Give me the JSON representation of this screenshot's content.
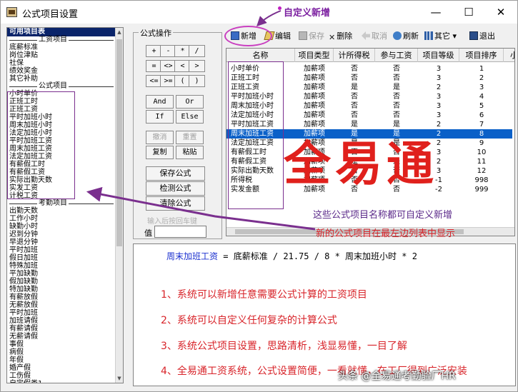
{
  "window": {
    "title": "公式项目设置",
    "min": "—",
    "max": "☐",
    "close": "✕"
  },
  "left_list": {
    "items": [
      {
        "type": "head",
        "text": "可用项目表"
      },
      {
        "type": "sep",
        "text": "工资项目"
      },
      {
        "type": "item",
        "text": "底薪标准"
      },
      {
        "type": "item",
        "text": "岗位津贴"
      },
      {
        "type": "item",
        "text": "社保"
      },
      {
        "type": "item",
        "text": "绩效奖金"
      },
      {
        "type": "item",
        "text": "其它补助"
      },
      {
        "type": "sep",
        "text": "公式项目"
      },
      {
        "type": "item",
        "text": "小时单价"
      },
      {
        "type": "item",
        "text": "正班工时"
      },
      {
        "type": "item",
        "text": "正班工资"
      },
      {
        "type": "item",
        "text": "平时加班小时"
      },
      {
        "type": "item",
        "text": "周末加班小时"
      },
      {
        "type": "item",
        "text": "法定加班小时"
      },
      {
        "type": "item",
        "text": "平时加班工资"
      },
      {
        "type": "item",
        "text": "周末加班工资"
      },
      {
        "type": "item",
        "text": "法定加班工资"
      },
      {
        "type": "item",
        "text": "有薪假工时"
      },
      {
        "type": "item",
        "text": "有薪假工资"
      },
      {
        "type": "item",
        "text": "实际出勤天数"
      },
      {
        "type": "item",
        "text": "实发工资"
      },
      {
        "type": "item",
        "text": "计税工资"
      },
      {
        "type": "sep",
        "text": "考勤项目"
      },
      {
        "type": "item",
        "text": "出勤天数"
      },
      {
        "type": "item",
        "text": "工作小时"
      },
      {
        "type": "item",
        "text": "缺勤小时"
      },
      {
        "type": "item",
        "text": "迟到分钟"
      },
      {
        "type": "item",
        "text": "早退分钟"
      },
      {
        "type": "item",
        "text": "平时加班"
      },
      {
        "type": "item",
        "text": "假日加班"
      },
      {
        "type": "item",
        "text": "特殊加班"
      },
      {
        "type": "item",
        "text": "平加缺勤"
      },
      {
        "type": "item",
        "text": "假加缺勤"
      },
      {
        "type": "item",
        "text": "特加缺勤"
      },
      {
        "type": "item",
        "text": "有薪放假"
      },
      {
        "type": "item",
        "text": "无薪放假"
      },
      {
        "type": "item",
        "text": "平时加班"
      },
      {
        "type": "item",
        "text": "加班请假"
      },
      {
        "type": "item",
        "text": "有薪请假"
      },
      {
        "type": "item",
        "text": "无薪请假"
      },
      {
        "type": "item",
        "text": "事假"
      },
      {
        "type": "item",
        "text": "病假"
      },
      {
        "type": "item",
        "text": "年假"
      },
      {
        "type": "item",
        "text": "婚产假"
      },
      {
        "type": "item",
        "text": "工伤假"
      },
      {
        "type": "item",
        "text": "自定假类1"
      }
    ]
  },
  "formula_ops": {
    "title": "公式操作",
    "operators": [
      "+",
      "-",
      "*",
      "/",
      "=",
      "<>",
      "<",
      ">",
      "<=",
      ">=",
      "(",
      ")"
    ],
    "and": "And",
    "or": "Or",
    "if": "If",
    "else": "Else",
    "undo": "撤消",
    "redo": "重置",
    "copy": "复制",
    "paste": "粘贴",
    "save": "保存公式",
    "check": "检测公式",
    "clear": "清除公式",
    "hint": "输入后按回车键",
    "value_label": "值"
  },
  "toolbar": {
    "new": "新增",
    "edit": "编辑",
    "save": "保存",
    "delete": "删除",
    "cancel": "取消",
    "refresh": "刷新",
    "other": "其它",
    "exit": "退出"
  },
  "table": {
    "columns": [
      "名称",
      "项目类型",
      "计所得税",
      "参与工资",
      "项目等级",
      "项目排序",
      "小"
    ],
    "rows": [
      [
        "小时单价",
        "加薪项",
        "否",
        "否",
        "3",
        "1"
      ],
      [
        "正班工时",
        "加薪项",
        "否",
        "否",
        "3",
        "2"
      ],
      [
        "正班工资",
        "加薪项",
        "是",
        "是",
        "2",
        "3"
      ],
      [
        "平时加班小时",
        "加薪项",
        "否",
        "否",
        "3",
        "4"
      ],
      [
        "周末加班小时",
        "加薪项",
        "否",
        "否",
        "3",
        "5"
      ],
      [
        "法定加班小时",
        "加薪项",
        "否",
        "否",
        "3",
        "6"
      ],
      [
        "平时加班工资",
        "加薪项",
        "是",
        "是",
        "2",
        "7"
      ],
      [
        "周末加班工资",
        "加薪项",
        "是",
        "是",
        "2",
        "8"
      ],
      [
        "法定加班工资",
        "加薪项",
        "是",
        "是",
        "2",
        "9"
      ],
      [
        "有薪假工时",
        "加薪项",
        "否",
        "否",
        "3",
        "10"
      ],
      [
        "有薪假工资",
        "加薪项",
        "是",
        "是",
        "2",
        "11"
      ],
      [
        "实际出勤天数",
        "加薪项",
        "否",
        "否",
        "3",
        "12"
      ],
      [
        "所得税",
        "扣薪项",
        "否",
        "否",
        "-1",
        "998"
      ],
      [
        "实发金额",
        "加薪项",
        "否",
        "否",
        "-2",
        "999"
      ]
    ],
    "selected_index": 7
  },
  "formula_text": {
    "name": "周末加班工资",
    "rest": " = 底薪标准 / 21.75 / 8 * 周末加班小时 * 2"
  },
  "notes": [
    "1、系统可以新增任意需要公式计算的工资项目",
    "2、系统可以自定义任何复杂的计算公式",
    "3、系统公式项目设置，思路清析，浅显易懂，一目了解",
    "4、全易通工资系统，公式设置简便，一看就懂，在工厂得到广泛安装"
  ],
  "annotations": {
    "callout": "自定义新增",
    "watermark": "全易通",
    "ann1": "这些公式项目名称都可自定义新增",
    "ann2": "新的公式项目在最左边列表中显示",
    "footer": "头条 @全易通考勤验厂HR"
  },
  "colors": {
    "selection": "#0a60c8",
    "list_head": "#0a246a",
    "note_red": "#d8242a",
    "annotation_purple": "#7a2f8e",
    "formula_blue": "#1a2fcf"
  }
}
